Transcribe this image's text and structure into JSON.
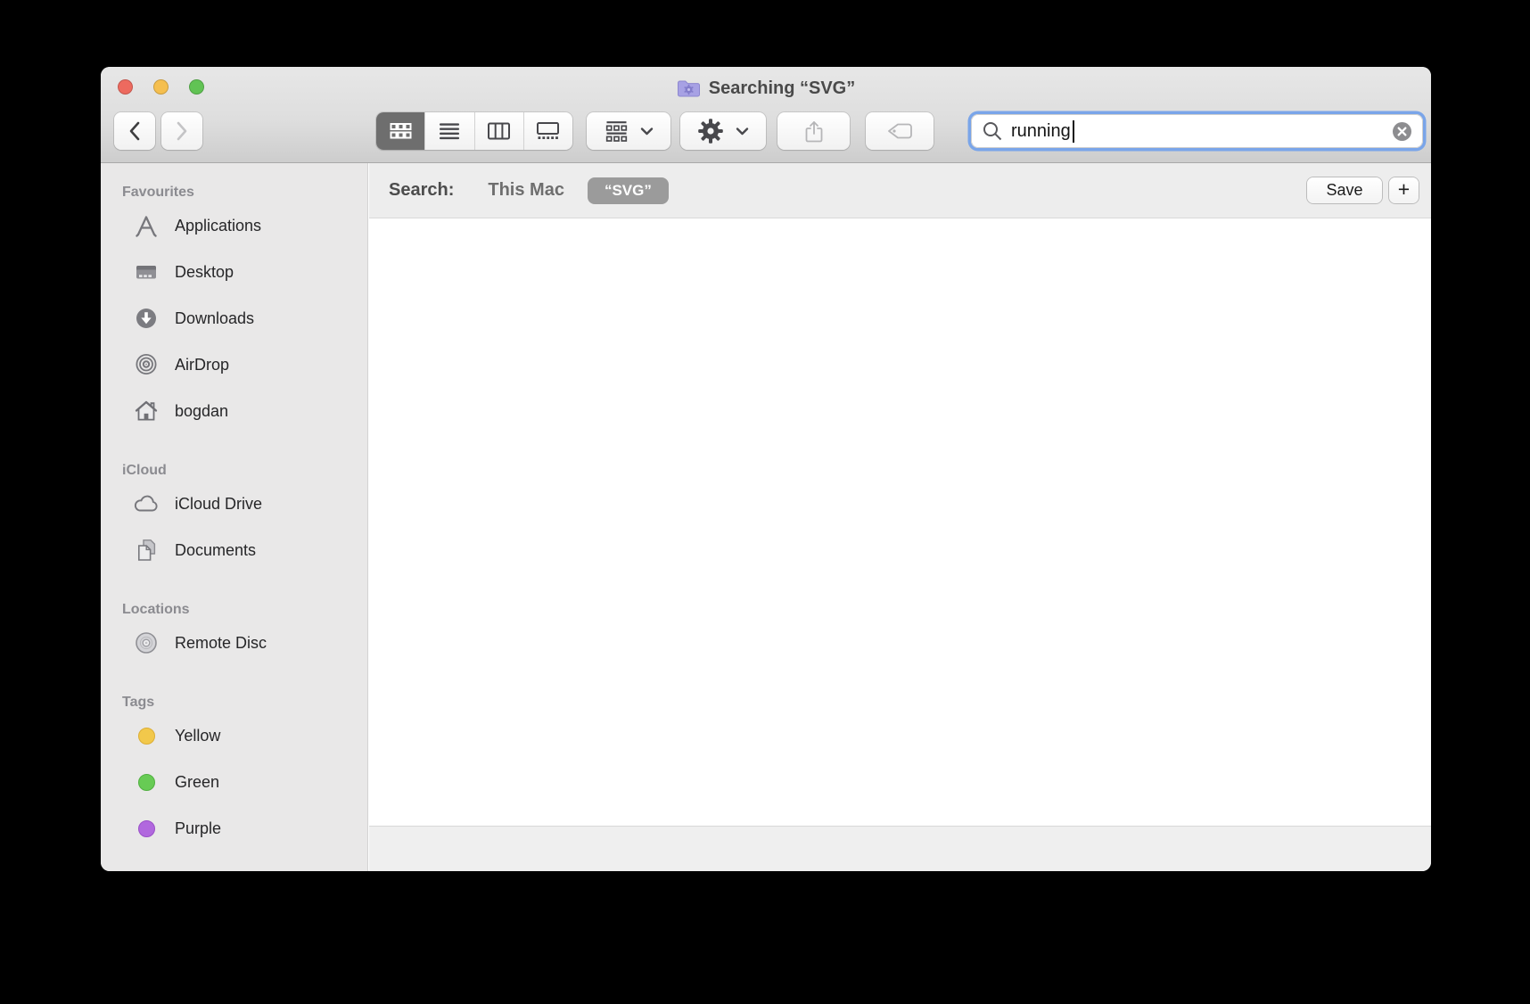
{
  "window": {
    "title": "Searching “SVG”",
    "title_icon": "smart-folder-icon",
    "controls": [
      "close",
      "minimize",
      "zoom"
    ]
  },
  "toolbar": {
    "view_modes": [
      "icon-view",
      "list-view",
      "column-view",
      "gallery-view"
    ],
    "selected_view": "icon-view",
    "buttons": [
      "back",
      "forward",
      "group-by",
      "action",
      "share",
      "tags"
    ],
    "search": {
      "value": "running",
      "icon": "search-icon",
      "clear_icon": "clear-icon"
    }
  },
  "search_header": {
    "label": "Search:",
    "scopes": [
      {
        "label": "This Mac",
        "active": false
      },
      {
        "label": "“SVG”",
        "active": true
      }
    ],
    "save_label": "Save",
    "add_label": "+"
  },
  "sidebar": {
    "sections": [
      {
        "title": "Favourites",
        "items": [
          {
            "label": "Applications",
            "icon": "applications-icon"
          },
          {
            "label": "Desktop",
            "icon": "desktop-icon"
          },
          {
            "label": "Downloads",
            "icon": "downloads-icon"
          },
          {
            "label": "AirDrop",
            "icon": "airdrop-icon"
          },
          {
            "label": "bogdan",
            "icon": "home-icon"
          }
        ]
      },
      {
        "title": "iCloud",
        "items": [
          {
            "label": "iCloud Drive",
            "icon": "icloud-drive-icon"
          },
          {
            "label": "Documents",
            "icon": "documents-icon"
          }
        ]
      },
      {
        "title": "Locations",
        "items": [
          {
            "label": "Remote Disc",
            "icon": "remote-disc-icon"
          }
        ]
      },
      {
        "title": "Tags",
        "items": [
          {
            "label": "Yellow",
            "icon": "tag-dot",
            "color": "#f2c84b",
            "border": "#dcae35"
          },
          {
            "label": "Green",
            "icon": "tag-dot",
            "color": "#67cb54",
            "border": "#50b040"
          },
          {
            "label": "Purple",
            "icon": "tag-dot",
            "color": "#b168de",
            "border": "#9a50c8"
          }
        ]
      }
    ]
  },
  "colors": {
    "traffic_red": "#ed6a5f",
    "traffic_yellow": "#f5bf4f",
    "traffic_green": "#61c354",
    "focus_ring": "#7aa5e9",
    "pill_bg": "#9b9b9b",
    "segment_selected": "#6e6e6e",
    "smart_folder": "#a7a1e4",
    "smart_folder_gear": "#837dcb"
  }
}
